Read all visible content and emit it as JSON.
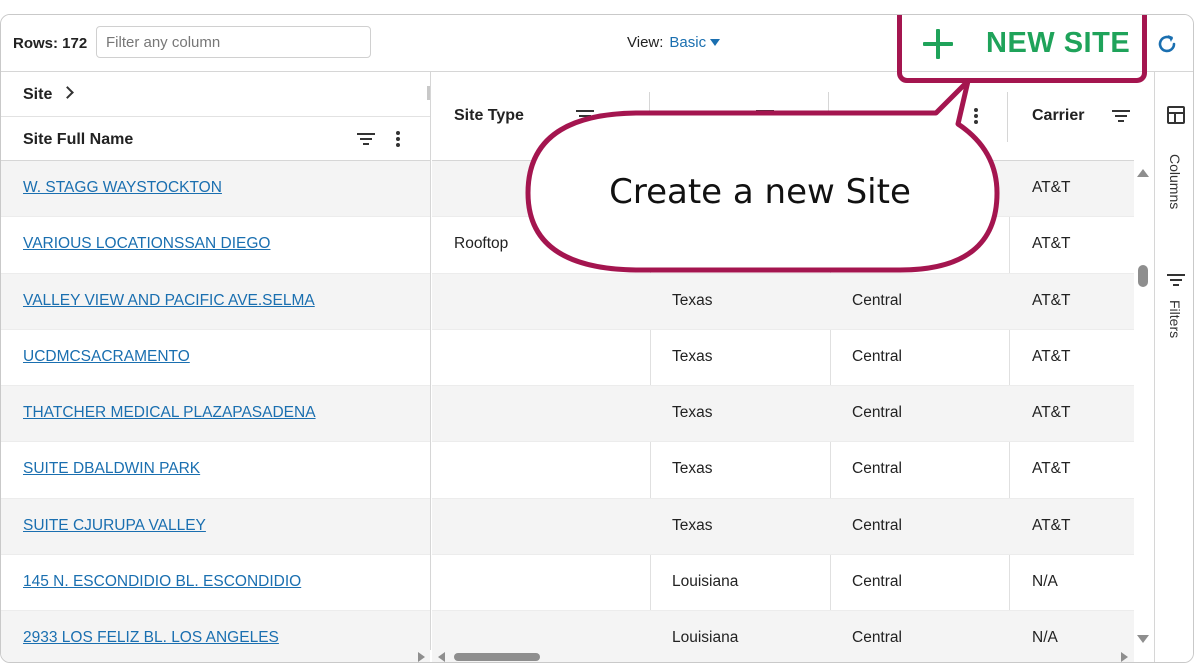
{
  "toolbar": {
    "rows_count": "Rows: 172",
    "filter_placeholder": "Filter any column",
    "view_label": "View:",
    "view_value": "Basic",
    "new_site_label": "NEW SITE"
  },
  "grid": {
    "pinned_header_group": "Site",
    "pinned_header": "Site Full Name",
    "headers": [
      "Site Type",
      "Carrier"
    ],
    "rows": [
      {
        "site": "W. STAGG WAYSTOCKTON",
        "type": "",
        "state": "",
        "region": "",
        "carrier": "AT&T"
      },
      {
        "site": "VARIOUS LOCATIONSSAN DIEGO",
        "type": "Rooftop",
        "state": "",
        "region": "",
        "carrier": "AT&T"
      },
      {
        "site": "VALLEY VIEW AND PACIFIC AVE.SELMA",
        "type": "",
        "state": "Texas",
        "region": "Central",
        "carrier": "AT&T"
      },
      {
        "site": "UCDMCSACRAMENTO",
        "type": "",
        "state": "Texas",
        "region": "Central",
        "carrier": "AT&T"
      },
      {
        "site": "THATCHER MEDICAL PLAZAPASADENA",
        "type": "",
        "state": "Texas",
        "region": "Central",
        "carrier": "AT&T"
      },
      {
        "site": "SUITE DBALDWIN PARK",
        "type": "",
        "state": "Texas",
        "region": "Central",
        "carrier": "AT&T"
      },
      {
        "site": "SUITE CJURUPA VALLEY",
        "type": "",
        "state": "Texas",
        "region": "Central",
        "carrier": "AT&T"
      },
      {
        "site": "145 N. ESCONDIDIO BL. ESCONDIDIO",
        "type": "",
        "state": "Louisiana",
        "region": "Central",
        "carrier": "N/A"
      },
      {
        "site": "2933 LOS FELIZ BL. LOS ANGELES",
        "type": "",
        "state": "Louisiana",
        "region": "Central",
        "carrier": "N/A"
      }
    ]
  },
  "side_panel": {
    "columns_label": "Columns",
    "filters_label": "Filters"
  },
  "callout": {
    "text": "Create a new Site"
  },
  "colors": {
    "accent_green": "#1fa35a",
    "link_blue": "#1a6fb0",
    "callout_border": "#a4154f"
  }
}
